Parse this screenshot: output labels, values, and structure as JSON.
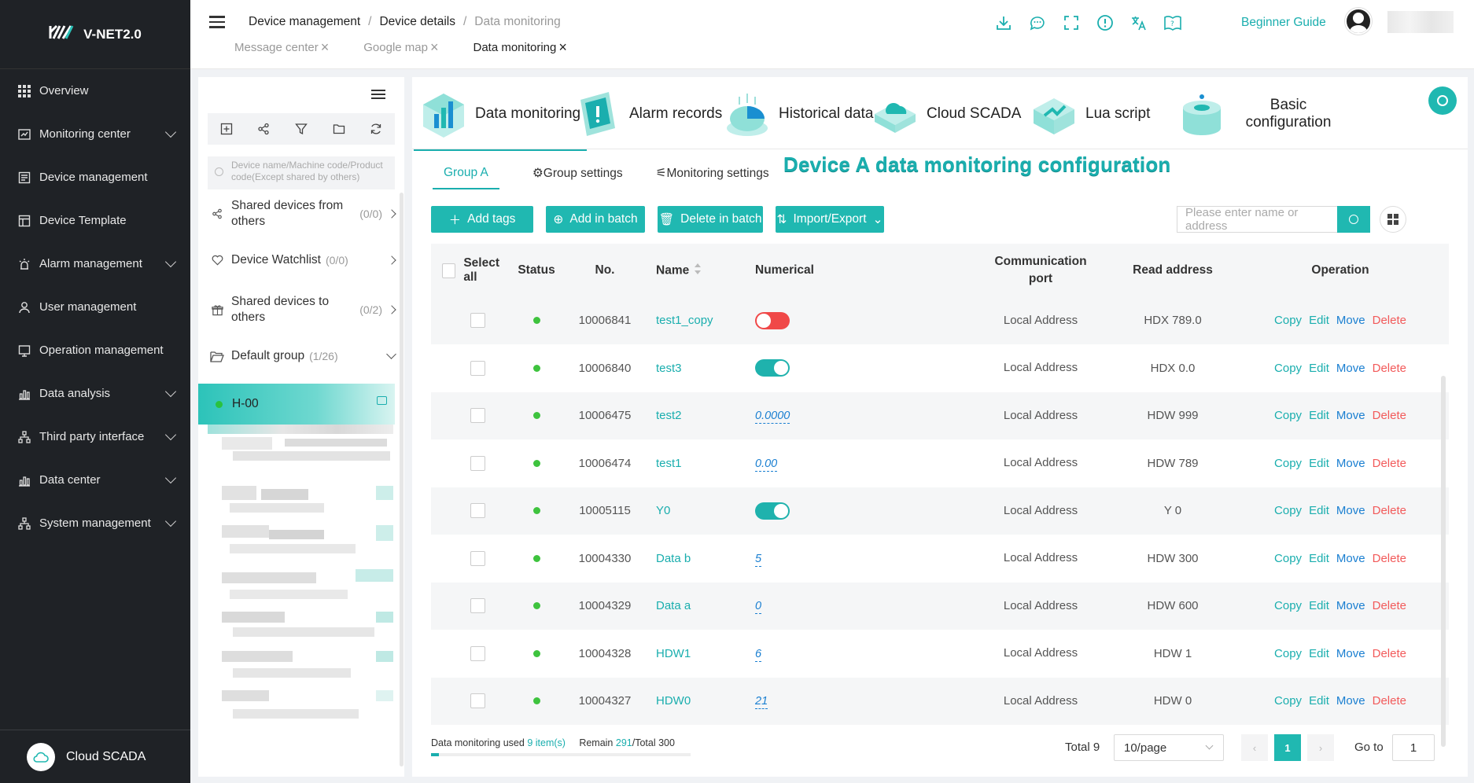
{
  "app": {
    "logo_text": "V-NET2.0",
    "accent_color": "#1aaeae"
  },
  "sidebar": {
    "items": [
      {
        "label": "Overview",
        "icon": "grid-icon",
        "expandable": false
      },
      {
        "label": "Monitoring center",
        "icon": "monitor-icon",
        "expandable": true
      },
      {
        "label": "Device management",
        "icon": "device-icon",
        "expandable": false
      },
      {
        "label": "Device Template",
        "icon": "template-icon",
        "expandable": false
      },
      {
        "label": "Alarm management",
        "icon": "alarm-icon",
        "expandable": true
      },
      {
        "label": "User management",
        "icon": "user-icon",
        "expandable": false
      },
      {
        "label": "Operation management",
        "icon": "operation-icon",
        "expandable": false
      },
      {
        "label": "Data analysis",
        "icon": "bar-chart-icon",
        "expandable": true
      },
      {
        "label": "Third party interface",
        "icon": "network-icon",
        "expandable": true
      },
      {
        "label": "Data center",
        "icon": "bar-chart-icon",
        "expandable": true
      },
      {
        "label": "System management",
        "icon": "network-icon",
        "expandable": true
      }
    ],
    "footer_label": "Cloud SCADA"
  },
  "header": {
    "breadcrumb": [
      "Device management",
      "Device details",
      "Data monitoring"
    ],
    "tabs": [
      {
        "label": "Message center",
        "active": false
      },
      {
        "label": "Google map",
        "active": false
      },
      {
        "label": "Data monitoring",
        "active": true
      }
    ],
    "guide_label": "Beginner Guide"
  },
  "device_panel": {
    "search_placeholder": "Device name/Machine code/Product code(Except shared by others)",
    "shared_from": {
      "label": "Shared devices from others",
      "count": "(0/0)"
    },
    "watchlist": {
      "label": "Device Watchlist",
      "count": "(0/0)"
    },
    "shared_to": {
      "label": "Shared devices to others",
      "count": "(0/2)"
    },
    "group": {
      "label": "Default group",
      "count": "(1/26)"
    },
    "selected_device": "H-00"
  },
  "modules": [
    {
      "label": "Data monitoring",
      "active": true
    },
    {
      "label": "Alarm records",
      "active": false
    },
    {
      "label": "Historical data",
      "active": false
    },
    {
      "label": "Cloud SCADA",
      "active": false
    },
    {
      "label": "Lua script",
      "active": false
    },
    {
      "label": "Basic configuration",
      "active": false
    }
  ],
  "subtabs": {
    "group": "Group A",
    "group_settings": "Group settings",
    "monitoring_settings": "Monitoring settings"
  },
  "page_title": "Device A data monitoring configuration",
  "actions": {
    "add_tags": "Add tags",
    "add_batch": "Add in batch",
    "delete_batch": "Delete in batch",
    "import_export": "Import/Export",
    "search_placeholder": "Please enter name or address"
  },
  "table": {
    "headers": {
      "select_all": "Select all",
      "status": "Status",
      "no": "No.",
      "name": "Name",
      "numerical": "Numerical",
      "comm_port": "Communication port",
      "read_address": "Read address",
      "operation": "Operation"
    },
    "op_labels": {
      "copy": "Copy",
      "edit": "Edit",
      "move": "Move",
      "delete": "Delete"
    },
    "rows": [
      {
        "no": "10006841",
        "name": "test1_copy",
        "value_type": "switch",
        "value": "off",
        "comm": "Local Address",
        "read": "HDX 789.0"
      },
      {
        "no": "10006840",
        "name": "test3",
        "value_type": "switch",
        "value": "on",
        "comm": "Local Address",
        "read": "HDX 0.0"
      },
      {
        "no": "10006475",
        "name": "test2",
        "value_type": "number",
        "value": "0.0000",
        "comm": "Local Address",
        "read": "HDW 999"
      },
      {
        "no": "10006474",
        "name": "test1",
        "value_type": "number",
        "value": "0.00",
        "comm": "Local Address",
        "read": "HDW 789"
      },
      {
        "no": "10005115",
        "name": "Y0",
        "value_type": "switch",
        "value": "on",
        "comm": "Local Address",
        "read": "Y 0"
      },
      {
        "no": "10004330",
        "name": "Data b",
        "value_type": "number",
        "value": "5",
        "comm": "Local Address",
        "read": "HDW 300"
      },
      {
        "no": "10004329",
        "name": "Data a",
        "value_type": "number",
        "value": "0",
        "comm": "Local Address",
        "read": "HDW 600"
      },
      {
        "no": "10004328",
        "name": "HDW1",
        "value_type": "number",
        "value": "6",
        "comm": "Local Address",
        "read": "HDW 1"
      },
      {
        "no": "10004327",
        "name": "HDW0",
        "value_type": "number",
        "value": "21",
        "comm": "Local Address",
        "read": "HDW 0"
      }
    ]
  },
  "usage": {
    "prefix": "Data monitoring used",
    "used": "9 item(s)",
    "remain_label": "Remain",
    "remain": "291",
    "total": "/Total 300",
    "fraction": 0.03
  },
  "pagination": {
    "total": "Total 9",
    "page_size": "10/page",
    "current": "1",
    "goto_label": "Go to",
    "goto_value": "1"
  }
}
